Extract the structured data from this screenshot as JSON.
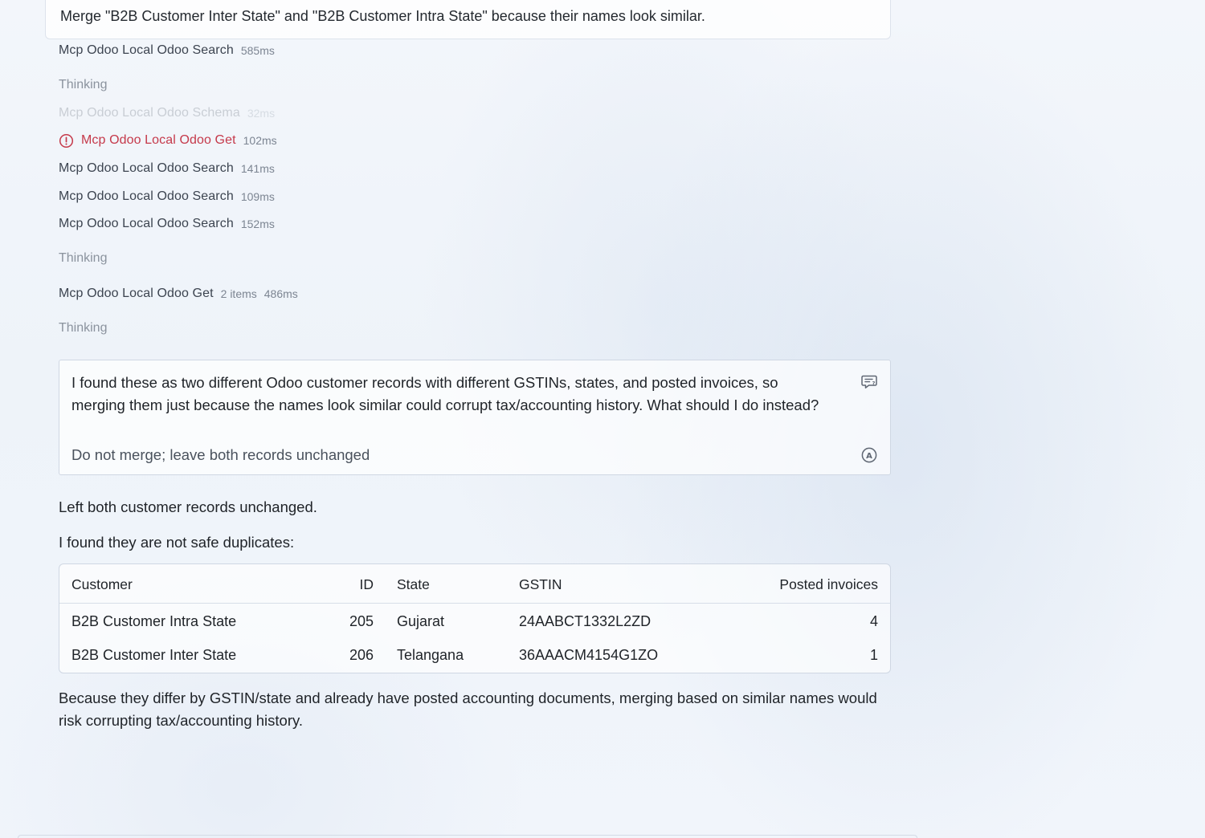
{
  "user_message": {
    "text": "Merge \"B2B Customer Inter State\" and \"B2B Customer Intra State\" because their names look similar."
  },
  "steps": [
    {
      "name": "Mcp Odoo Local Odoo Search",
      "duration": "585ms"
    },
    {
      "thinking": "Thinking"
    },
    {
      "name": "Mcp Odoo Local Odoo Schema",
      "duration": "32ms"
    },
    {
      "name": "Mcp Odoo Local Odoo Get",
      "duration": "102ms",
      "status": "error"
    },
    {
      "name": "Mcp Odoo Local Odoo Search",
      "duration": "141ms"
    },
    {
      "name": "Mcp Odoo Local Odoo Search",
      "duration": "109ms"
    },
    {
      "name": "Mcp Odoo Local Odoo Search",
      "duration": "152ms"
    },
    {
      "thinking": "Thinking"
    },
    {
      "name": "Mcp Odoo Local Odoo Get",
      "items": "2 items",
      "duration": "486ms"
    },
    {
      "thinking": "Thinking"
    }
  ],
  "question_card": {
    "question": "I found these as two different Odoo customer records with different GSTINs, states, and posted invoices, so merging them just because the names look similar could corrupt tax/accounting history. What should I do instead?",
    "answer": "Do not merge; leave both records unchanged",
    "question_icon": "chat-question-icon",
    "answer_icon": "answer-badge-icon"
  },
  "response": {
    "line1": "Left both customer records unchanged.",
    "line2": "I found they are not safe duplicates:",
    "conclusion": "Because they differ by GSTIN/state and already have posted accounting documents, merging based on similar names would risk corrupting tax/accounting history."
  },
  "table": {
    "headers": {
      "customer": "Customer",
      "id": "ID",
      "state": "State",
      "gstin": "GSTIN",
      "posted": "Posted invoices"
    },
    "rows": [
      {
        "customer": "B2B Customer Intra State",
        "id": "205",
        "state": "Gujarat",
        "gstin": "24AABCT1332L2ZD",
        "posted": "4"
      },
      {
        "customer": "B2B Customer Inter State",
        "id": "206",
        "state": "Telangana",
        "gstin": "36AAACM4154G1ZO",
        "posted": "1"
      }
    ]
  },
  "colors": {
    "error": "#c5394a",
    "muted": "#8b939e",
    "border": "#cfd7e3"
  }
}
